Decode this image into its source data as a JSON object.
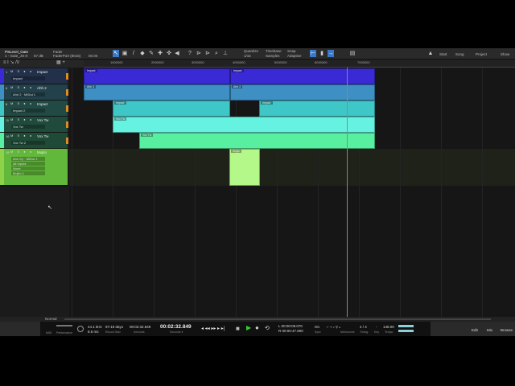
{
  "toolbar": {
    "song_title": "PSLevel_Gate",
    "track_name": "1 - Gate_JG-II",
    "level": "57 dB",
    "fader_label": "Fader",
    "fader_device": "FaderPort (8016)",
    "fader_value": "00.00",
    "quantize_label": "Quantize",
    "quantize_value": "1/16",
    "timebase_label": "Timebase",
    "timebase_value": "Samples",
    "snap_label": "Snap",
    "snap_value": "Adaptive",
    "start": "Start",
    "song": "Song",
    "project": "Project",
    "show": "Show"
  },
  "ruler": {
    "labels": [
      "1000000",
      "2000000",
      "3000000",
      "4000000",
      "5000000",
      "6000000",
      "7000000"
    ]
  },
  "tracks": [
    {
      "num": "1",
      "name": "Impact",
      "subs": [
        "Impact"
      ],
      "color": "#3a2ad6"
    },
    {
      "num": "6",
      "name": "Ahh 2",
      "subs": [
        "Ahh 2 · MIDut 1"
      ],
      "color": "#3d8fc4"
    },
    {
      "num": "8",
      "name": "Impact",
      "subs": [
        "Impact 2"
      ],
      "color": "#3fc7c7"
    },
    {
      "num": "11",
      "name": "Vox Tw",
      "subs": [
        "Vox Tw"
      ],
      "color": "#66f2e0"
    },
    {
      "num": "16",
      "name": "Vox Tw",
      "subs": [
        "Vox Tw 2"
      ],
      "color": "#58efa0"
    },
    {
      "num": "18",
      "name": "Mojito",
      "subs": [
        "Ahh 2(r · MIDut 1",
        "All Inputs",
        "None",
        "Mojito 1"
      ],
      "color": "#8ed24a"
    }
  ],
  "clips": {
    "c1a": "Impact",
    "c1b": "Impact",
    "c2a": "Ahh 2",
    "c2b": "Ahh 2",
    "c3a": "Impact",
    "c3b": "Impact",
    "c4": "Vox Tw",
    "c5": "Vox Tw",
    "c6": "Mojito"
  },
  "bottom": {
    "mode": "Normal"
  },
  "transport": {
    "midi": "MIDI",
    "performance": "Performance",
    "sample_rate": "44.1 kHz",
    "latency": "8.6 ms",
    "record_days": "97:19 days",
    "record_max": "Record Max",
    "time_small": "00:02:32.849",
    "seconds": "Seconds",
    "time_big": "00:02:32.849",
    "seconds_dd": "Seconds ▾",
    "loop_l": "L  00:00:09.070",
    "loop_r": "R  00:00:47.800",
    "sync_on": "On",
    "sync": "Sync",
    "metronome": "Metronome",
    "timing_value": "4 / 4",
    "timing": "Timing",
    "key_value": "-",
    "key": "Key",
    "tempo_value": "148.00",
    "tempo": "Tempo",
    "edit": "Edit",
    "mix": "Mix",
    "browse": "Browse"
  }
}
